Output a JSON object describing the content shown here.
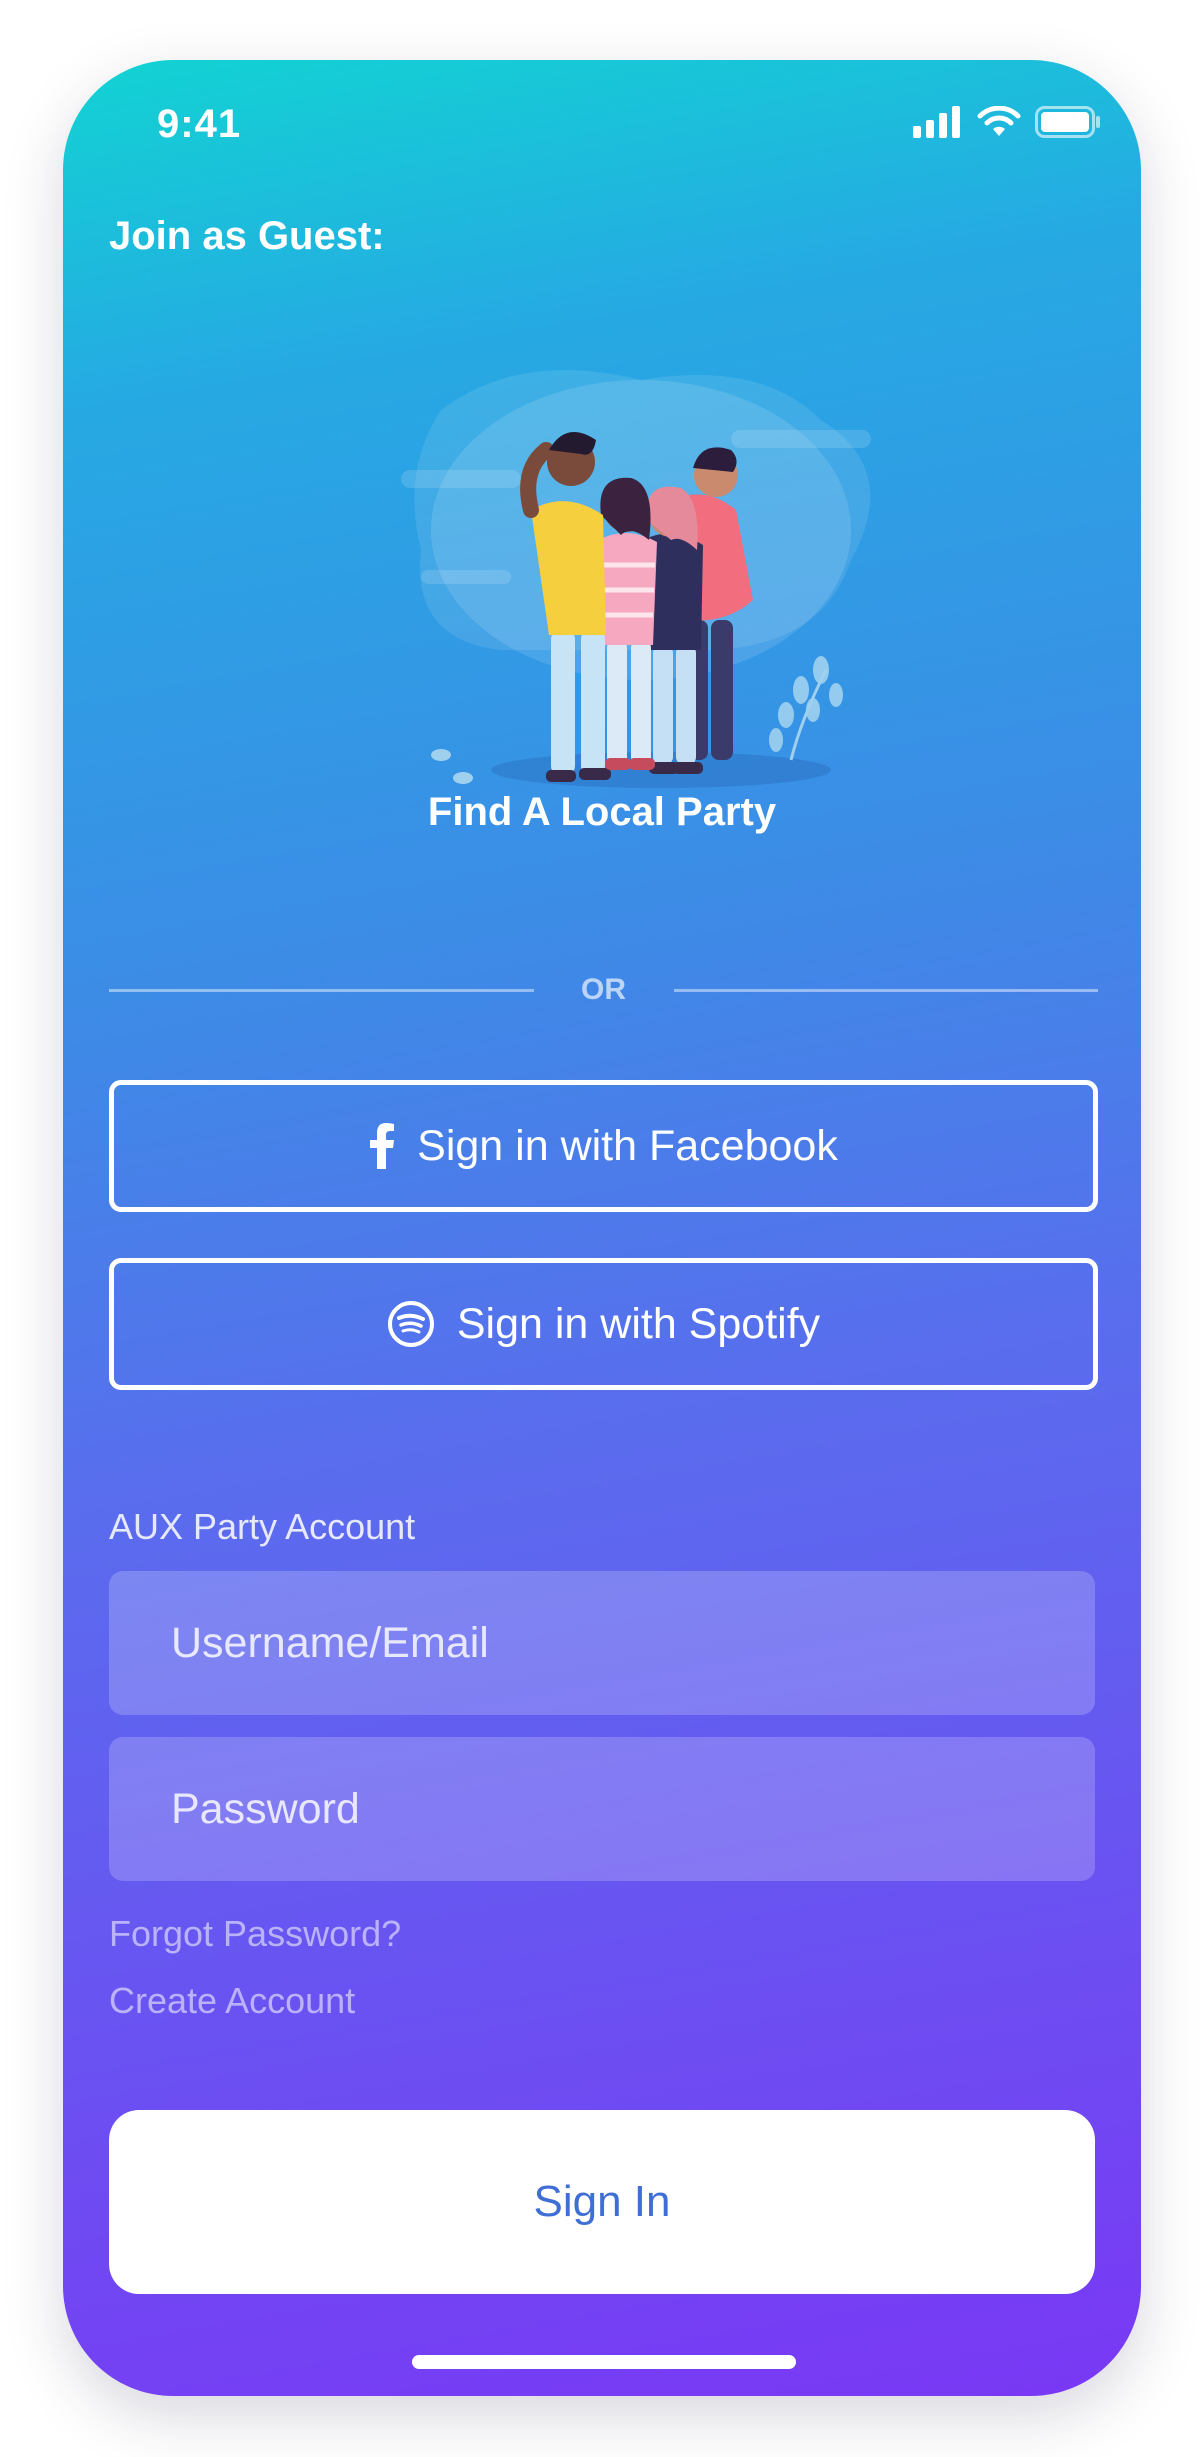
{
  "status_bar": {
    "time": "9:41",
    "icons": [
      "cellular-signal-icon",
      "wifi-icon",
      "battery-icon"
    ]
  },
  "guest_section": {
    "title": "Join as Guest:",
    "illustration": "group-of-friends-illustration",
    "find_party_label": "Find A Local Party"
  },
  "divider": {
    "label": "OR"
  },
  "social_login": {
    "facebook": {
      "label": "Sign in with Facebook",
      "icon": "facebook-icon"
    },
    "spotify": {
      "label": "Sign in with Spotify",
      "icon": "spotify-icon"
    }
  },
  "account_form": {
    "section_label": "AUX Party Account",
    "username": {
      "placeholder": "Username/Email",
      "value": ""
    },
    "password": {
      "placeholder": "Password",
      "value": ""
    },
    "forgot_password_label": "Forgot Password?",
    "create_account_label": "Create Account",
    "sign_in_label": "Sign In"
  },
  "colors": {
    "gradient_top": "#12d3d3",
    "gradient_mid": "#5a6cee",
    "gradient_bottom": "#7a38f4",
    "sign_in_text": "#3f6fd6"
  }
}
